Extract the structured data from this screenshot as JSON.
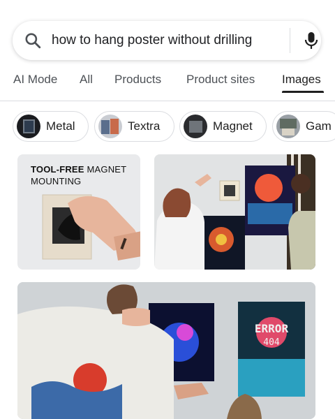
{
  "search": {
    "query": "how to hang poster without drilling"
  },
  "tabs": [
    {
      "label": "AI Mode",
      "active": false
    },
    {
      "label": "All",
      "active": false
    },
    {
      "label": "Products",
      "active": false
    },
    {
      "label": "Product sites",
      "active": false
    },
    {
      "label": "Images",
      "active": true
    }
  ],
  "chips": [
    {
      "label": "Metal"
    },
    {
      "label": "Textra"
    },
    {
      "label": "Magnet"
    },
    {
      "label": "Gam"
    }
  ],
  "results": {
    "card1": {
      "title_bold": "TOOL-FREE",
      "title_rest": " MAGNET",
      "title_line2": "MOUNTING"
    },
    "card3_poster_text": {
      "line1": "ERROR",
      "line2": "404"
    }
  },
  "colors": {
    "text": "#1f1f1f",
    "muted": "#4d5156",
    "border": "#dadce0"
  },
  "icons": [
    "search-icon",
    "microphone-icon"
  ]
}
